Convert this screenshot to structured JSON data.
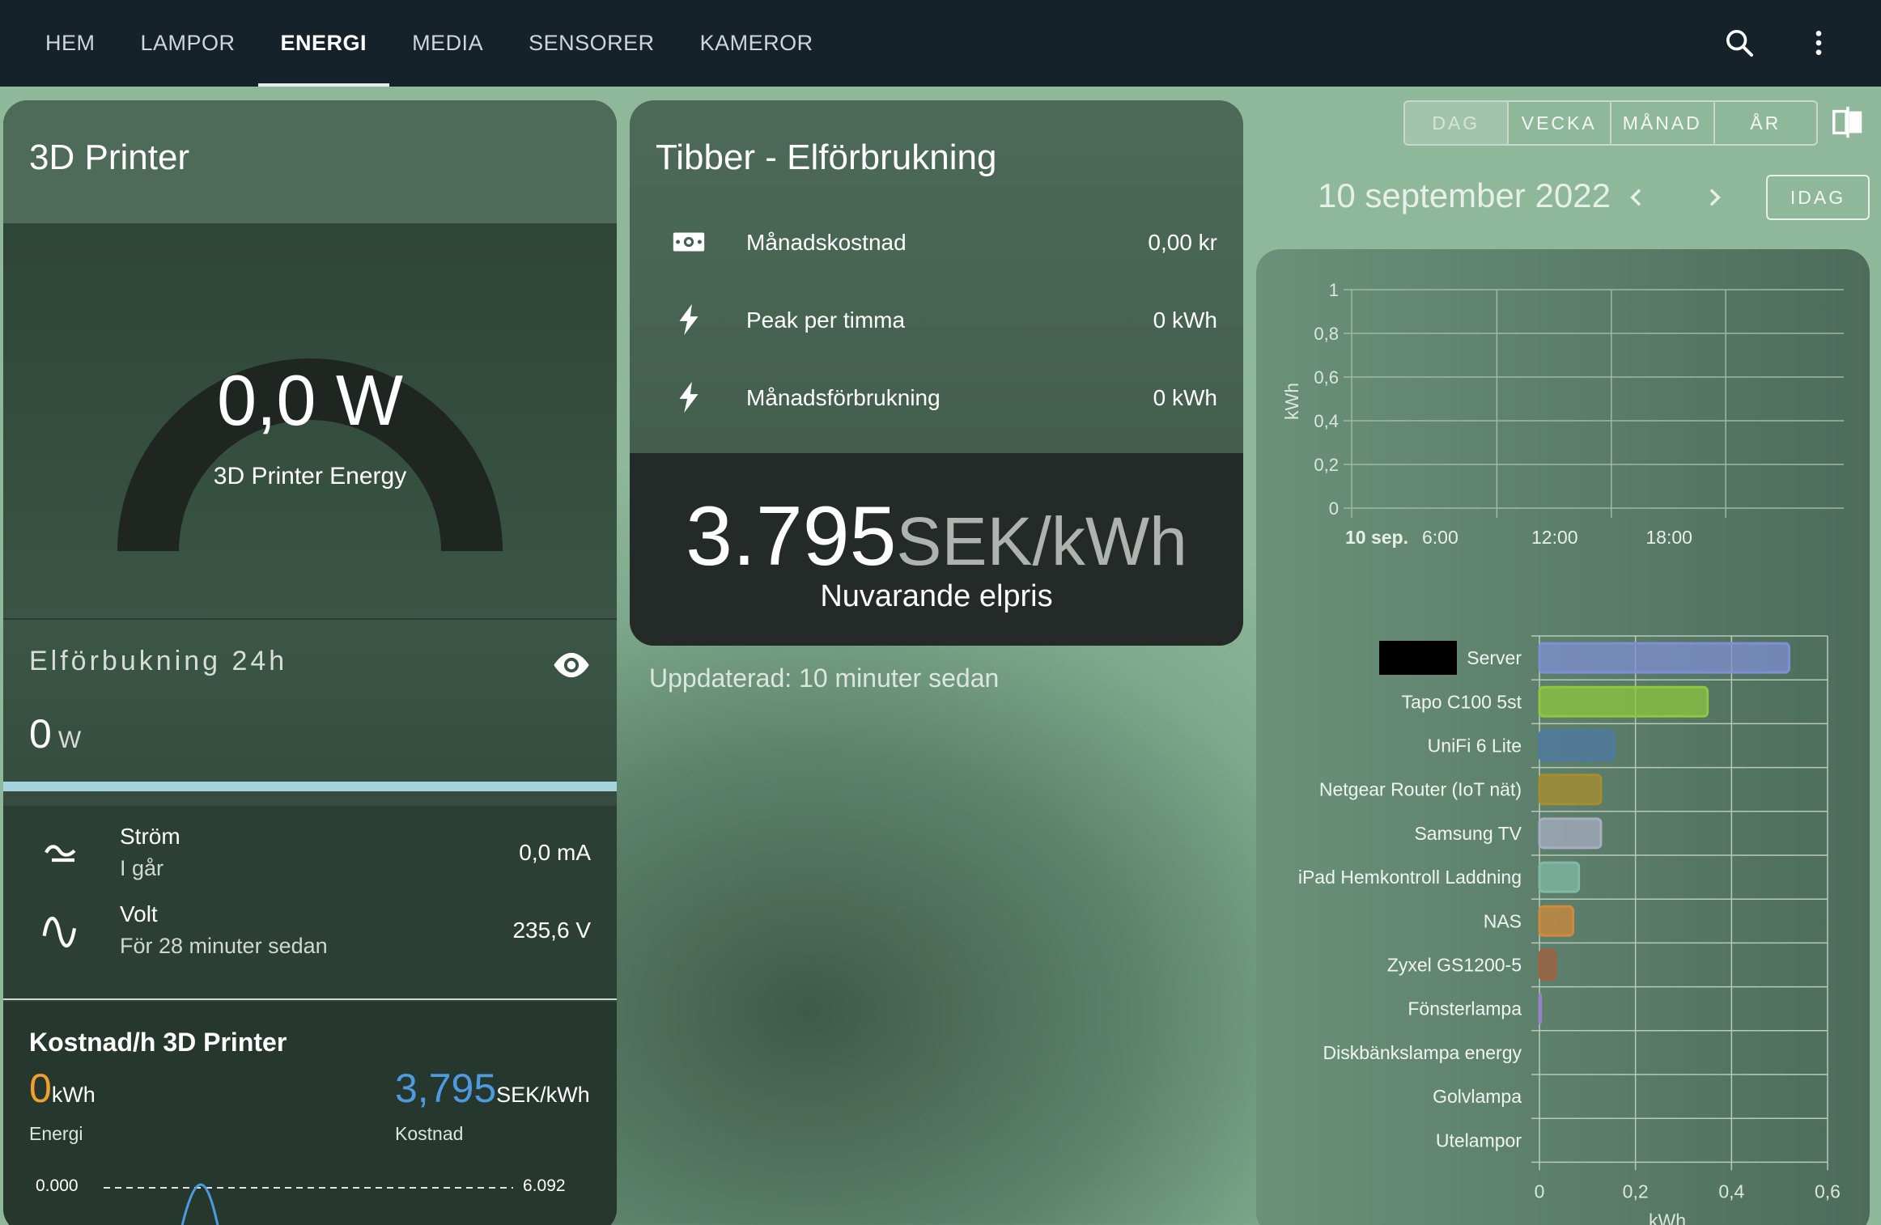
{
  "nav": {
    "tabs": [
      "HEM",
      "LAMPOR",
      "ENERGI",
      "MEDIA",
      "SENSORER",
      "KAMEROR"
    ],
    "active_tab": "ENERGI"
  },
  "printer": {
    "title": "3D Printer",
    "gauge_value": "0,0 W",
    "gauge_label": "3D Printer Energy",
    "gauge_fraction": 0,
    "consumption_title": "Elförbukning 24h",
    "consumption_value": "0",
    "consumption_unit": "W",
    "sensors": [
      {
        "name": "Ström",
        "sub": "I går",
        "value": "0,0 mA",
        "icon": "current-ac-icon"
      },
      {
        "name": "Volt",
        "sub": "För 28 minuter sedan",
        "value": "235,6 V",
        "icon": "sine-wave-icon"
      }
    ],
    "cost": {
      "title": "Kostnad/h 3D Printer",
      "energy_value": "0",
      "energy_unit": "kWh",
      "energy_label": "Energi",
      "cost_value": "3,795",
      "cost_unit": "SEK/kWh",
      "cost_label": "Kostnad",
      "min_label": "0.000",
      "max_label": "6.092"
    }
  },
  "tibber": {
    "title": "Tibber - Elförbrukning",
    "rows": [
      {
        "icon": "cash-icon",
        "name": "Månadskostnad",
        "value": "0,00 kr"
      },
      {
        "icon": "flash-icon",
        "name": "Peak per timma",
        "value": "0 kWh"
      },
      {
        "icon": "flash-icon",
        "name": "Månadsförbrukning",
        "value": "0 kWh"
      }
    ],
    "price_value": "3.795",
    "price_unit": "SEK/kWh",
    "price_label": "Nuvarande elpris",
    "updated": "Uppdaterad: 10 minuter sedan"
  },
  "energy_period": {
    "buttons": [
      "DAG",
      "VECKA",
      "MÅNAD",
      "ÅR"
    ],
    "active": "DAG",
    "date": "10 september 2022",
    "today_label": "IDAG"
  },
  "chart_data": [
    {
      "type": "bar",
      "title": "",
      "ylabel": "kWh",
      "ylim": [
        0,
        1
      ],
      "y_ticks": [
        "0",
        "0,2",
        "0,4",
        "0,6",
        "0,8",
        "1"
      ],
      "x_ticks": [
        "10 sep.",
        "6:00",
        "12:00",
        "18:00"
      ],
      "series": []
    },
    {
      "type": "bar",
      "orientation": "horizontal",
      "xlabel": "kWh",
      "xlim": [
        0,
        0.6
      ],
      "x_ticks": [
        "0",
        "0,2",
        "0,4",
        "0,6"
      ],
      "categories": [
        "Server",
        "Tapo C100 5st",
        "UniFi 6 Lite",
        "Netgear Router (IoT nät)",
        "Samsung TV",
        "iPad Hemkontroll Laddning",
        "NAS",
        "Zyxel GS1200-5",
        "Fönsterlampa",
        "Diskbänkslampa energy",
        "Golvlampa",
        "Utelampor"
      ],
      "values": [
        0.52,
        0.35,
        0.155,
        0.128,
        0.128,
        0.082,
        0.07,
        0.033,
        0.003,
        0,
        0,
        0
      ],
      "colors": [
        "#7e8fd2",
        "#8fc63f",
        "#4f7aa3",
        "#a88d2d",
        "#a7aec2",
        "#80b9a6",
        "#d08a3c",
        "#a3603f",
        "#9c7fc7",
        "#888888",
        "#888888",
        "#888888"
      ]
    }
  ]
}
